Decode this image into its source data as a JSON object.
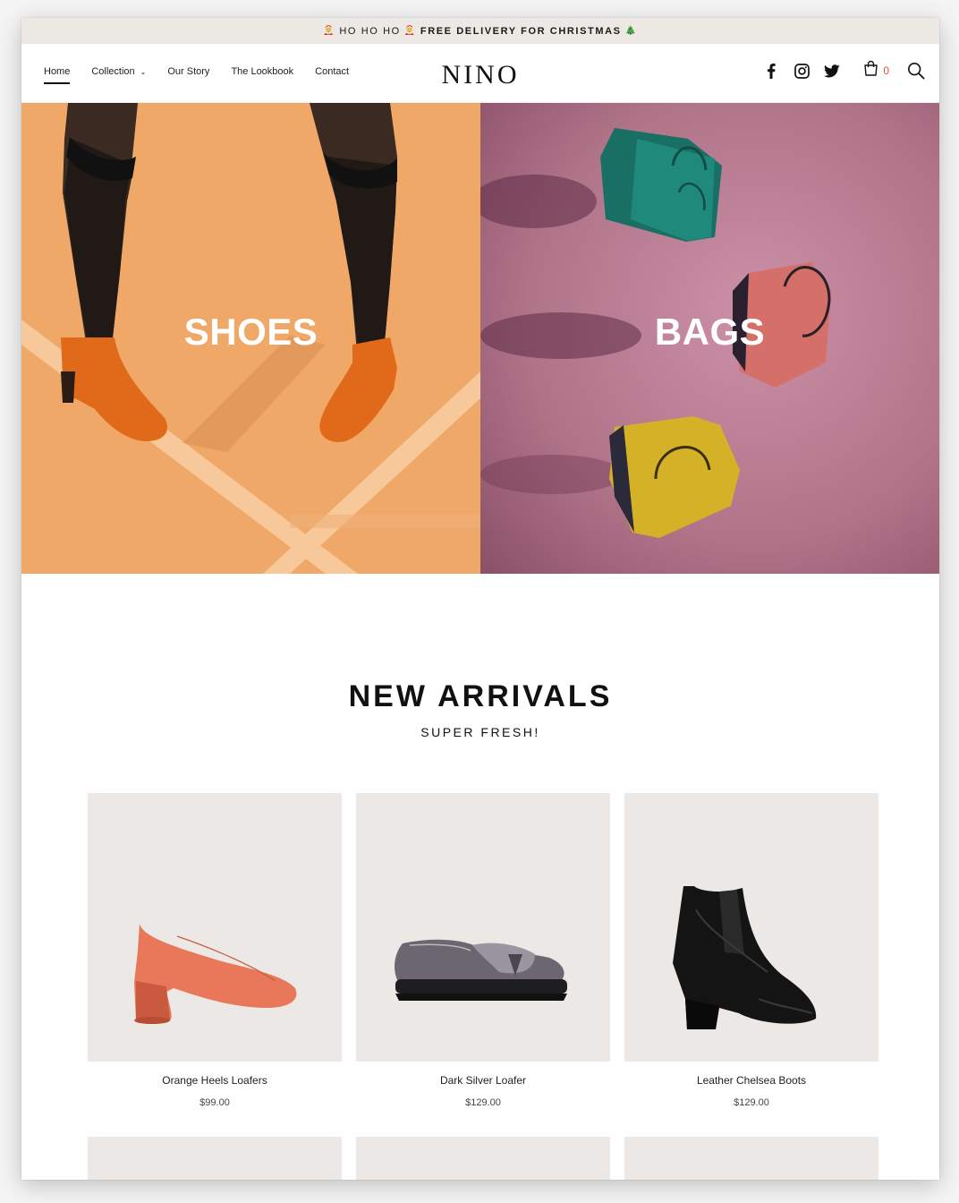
{
  "announcement": {
    "emoji_left": "🤶",
    "text_a": "HO HO HO",
    "emoji_mid": "🤶",
    "text_b": "FREE DELIVERY FOR CHRISTMAS",
    "emoji_right": "🎄"
  },
  "nav": {
    "items": [
      {
        "label": "Home",
        "active": true
      },
      {
        "label": "Collection",
        "dropdown": true
      },
      {
        "label": "Our Story"
      },
      {
        "label": "The Lookbook"
      },
      {
        "label": "Contact"
      }
    ]
  },
  "brand": {
    "logo": "NINO"
  },
  "header_icons": [
    "facebook-icon",
    "instagram-icon",
    "twitter-icon",
    "cart-icon",
    "search-icon"
  ],
  "cart": {
    "count": "0"
  },
  "hero": {
    "tiles": [
      {
        "label": "SHOES",
        "color": "#f0a869"
      },
      {
        "label": "BAGS",
        "color": "#b07489"
      }
    ]
  },
  "new_arrivals": {
    "title": "NEW ARRIVALS",
    "subtitle": "SUPER FRESH!",
    "products": [
      {
        "name": "Orange Heels Loafers",
        "price": "$99.00"
      },
      {
        "name": "Dark Silver Loafer",
        "price": "$129.00"
      },
      {
        "name": "Leather Chelsea Boots",
        "price": "$129.00"
      }
    ]
  },
  "colors": {
    "accent": "#e0533c",
    "announce_bg": "#ece8e4",
    "card_bg": "#ebe8e5"
  }
}
